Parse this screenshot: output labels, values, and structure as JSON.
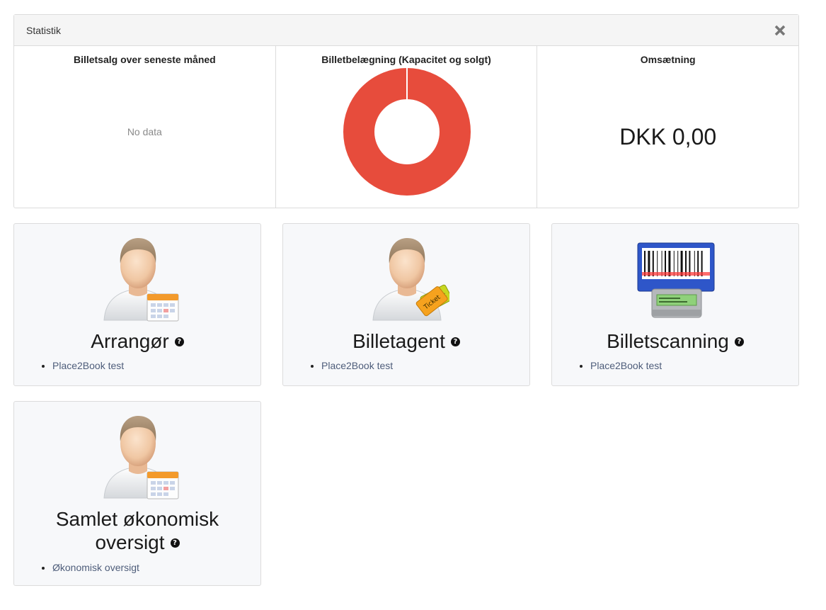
{
  "statistik": {
    "title": "Statistik",
    "close_icon": "close-icon",
    "columns": {
      "sales": {
        "title": "Billetsalg over seneste måned",
        "empty_text": "No data"
      },
      "occupancy": {
        "title": "Billetbelægning (Kapacitet og solgt)"
      },
      "revenue": {
        "title": "Omsætning",
        "value": "DKK 0,00"
      }
    }
  },
  "chart_data": {
    "type": "pie",
    "title": "Billetbelægning (Kapacitet og solgt)",
    "donut": true,
    "slices": [
      {
        "value": 100,
        "color": "#e74c3c"
      },
      {
        "value": 0,
        "color": "#e74c3c"
      }
    ]
  },
  "cards": [
    {
      "title": "Arrangør",
      "icon": "organizer-person-calendar-icon",
      "links": [
        "Place2Book test"
      ]
    },
    {
      "title": "Billetagent",
      "icon": "ticket-agent-person-ticket-icon",
      "links": [
        "Place2Book test"
      ]
    },
    {
      "title": "Billetscanning",
      "icon": "barcode-scanner-icon",
      "links": [
        "Place2Book test"
      ]
    },
    {
      "title_line1": "Samlet økonomisk",
      "title_line2": "oversigt",
      "icon": "finance-person-calendar-icon",
      "links": [
        "Økonomisk oversigt"
      ]
    }
  ],
  "colors": {
    "donut": "#e74c3c",
    "card_bg": "#f7f8fa",
    "link": "#4e5d7a"
  }
}
